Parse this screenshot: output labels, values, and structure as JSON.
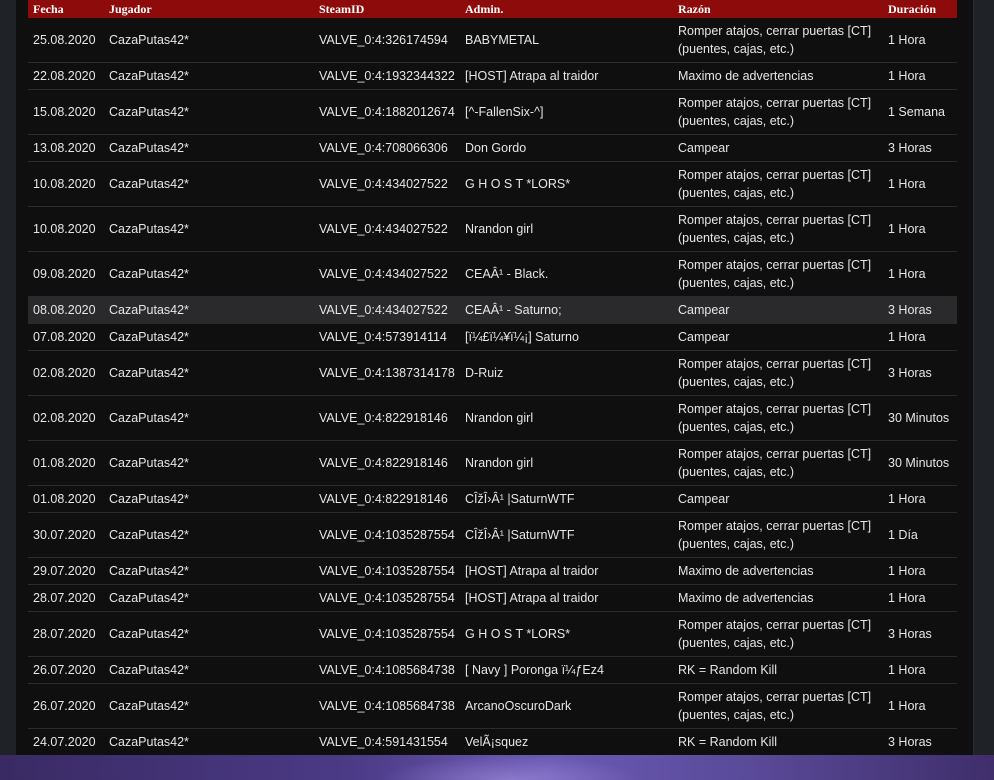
{
  "table": {
    "headers": {
      "fecha": "Fecha",
      "jugador": "Jugador",
      "steamid": "SteamID",
      "admin": "Admin.",
      "razon": "Razón",
      "duracion": "Duración"
    },
    "rows": [
      {
        "fecha": "25.08.2020",
        "jugador": "CazaPutas42*",
        "steamid": "VALVE_0:4:326174594",
        "admin": "BABYMETAL",
        "razon": "Romper atajos, cerrar puertas [CT] (puentes, cajas, etc.)",
        "duracion": "1 Hora"
      },
      {
        "fecha": "22.08.2020",
        "jugador": "CazaPutas42*",
        "steamid": "VALVE_0:4:1932344322",
        "admin": "[HOST] Atrapa al traidor",
        "razon": "Maximo de advertencias",
        "duracion": "1 Hora"
      },
      {
        "fecha": "15.08.2020",
        "jugador": "CazaPutas42*",
        "steamid": "VALVE_0:4:1882012674",
        "admin": "[^-FallenSix-^]",
        "razon": "Romper atajos, cerrar puertas [CT] (puentes, cajas, etc.)",
        "duracion": "1 Semana"
      },
      {
        "fecha": "13.08.2020",
        "jugador": "CazaPutas42*",
        "steamid": "VALVE_0:4:708066306",
        "admin": "Don Gordo",
        "razon": "Campear",
        "duracion": "3 Horas"
      },
      {
        "fecha": "10.08.2020",
        "jugador": "CazaPutas42*",
        "steamid": "VALVE_0:4:434027522",
        "admin": "G H O S T *LORS*",
        "razon": "Romper atajos, cerrar puertas [CT] (puentes, cajas, etc.)",
        "duracion": "1 Hora"
      },
      {
        "fecha": "10.08.2020",
        "jugador": "CazaPutas42*",
        "steamid": "VALVE_0:4:434027522",
        "admin": "Nrandon girl",
        "razon": "Romper atajos, cerrar puertas [CT] (puentes, cajas, etc.)",
        "duracion": "1 Hora"
      },
      {
        "fecha": "09.08.2020",
        "jugador": "CazaPutas42*",
        "steamid": "VALVE_0:4:434027522",
        "admin": "CEAÂ¹ - Black.",
        "razon": "Romper atajos, cerrar puertas [CT] (puentes, cajas, etc.)",
        "duracion": "1 Hora"
      },
      {
        "fecha": "08.08.2020",
        "jugador": "CazaPutas42*",
        "steamid": "VALVE_0:4:434027522",
        "admin": "CEAÂ¹ - Saturno;",
        "razon": "Campear",
        "duracion": "3 Horas"
      },
      {
        "fecha": "07.08.2020",
        "jugador": "CazaPutas42*",
        "steamid": "VALVE_0:4:573914114",
        "admin": "[ï¼£ï¼¥ï¼¡] Saturno",
        "razon": "Campear",
        "duracion": "1 Hora"
      },
      {
        "fecha": "02.08.2020",
        "jugador": "CazaPutas42*",
        "steamid": "VALVE_0:4:1387314178",
        "admin": "D-Ruiz",
        "razon": "Romper atajos, cerrar puertas [CT] (puentes, cajas, etc.)",
        "duracion": "3 Horas"
      },
      {
        "fecha": "02.08.2020",
        "jugador": "CazaPutas42*",
        "steamid": "VALVE_0:4:822918146",
        "admin": "Nrandon girl",
        "razon": "Romper atajos, cerrar puertas [CT] (puentes, cajas, etc.)",
        "duracion": "30 Minutos"
      },
      {
        "fecha": "01.08.2020",
        "jugador": "CazaPutas42*",
        "steamid": "VALVE_0:4:822918146",
        "admin": "Nrandon girl",
        "razon": "Romper atajos, cerrar puertas [CT] (puentes, cajas, etc.)",
        "duracion": "30 Minutos"
      },
      {
        "fecha": "01.08.2020",
        "jugador": "CazaPutas42*",
        "steamid": "VALVE_0:4:822918146",
        "admin": "CÎžÎ›Â¹ |SaturnWTF",
        "razon": "Campear",
        "duracion": "1 Hora"
      },
      {
        "fecha": "30.07.2020",
        "jugador": "CazaPutas42*",
        "steamid": "VALVE_0:4:1035287554",
        "admin": "CÎžÎ›Â¹ |SaturnWTF",
        "razon": "Romper atajos, cerrar puertas [CT] (puentes, cajas, etc.)",
        "duracion": "1 Día"
      },
      {
        "fecha": "29.07.2020",
        "jugador": "CazaPutas42*",
        "steamid": "VALVE_0:4:1035287554",
        "admin": "[HOST] Atrapa al traidor",
        "razon": "Maximo de advertencias",
        "duracion": "1 Hora"
      },
      {
        "fecha": "28.07.2020",
        "jugador": "CazaPutas42*",
        "steamid": "VALVE_0:4:1035287554",
        "admin": "[HOST] Atrapa al traidor",
        "razon": "Maximo de advertencias",
        "duracion": "1 Hora"
      },
      {
        "fecha": "28.07.2020",
        "jugador": "CazaPutas42*",
        "steamid": "VALVE_0:4:1035287554",
        "admin": "G H O S T *LORS*",
        "razon": "Romper atajos, cerrar puertas [CT] (puentes, cajas, etc.)",
        "duracion": "3 Horas"
      },
      {
        "fecha": "26.07.2020",
        "jugador": "CazaPutas42*",
        "steamid": "VALVE_0:4:1085684738",
        "admin": "[ Navy ] Poronga ï¼ƒEz4",
        "razon": "RK = Random Kill",
        "duracion": "1 Hora"
      },
      {
        "fecha": "26.07.2020",
        "jugador": "CazaPutas42*",
        "steamid": "VALVE_0:4:1085684738",
        "admin": "ArcanoOscuroDark",
        "razon": "Romper atajos, cerrar puertas [CT] (puentes, cajas, etc.)",
        "duracion": "1 Hora"
      },
      {
        "fecha": "24.07.2020",
        "jugador": "CazaPutas42*",
        "steamid": "VALVE_0:4:591431554",
        "admin": "VelÃ¡squez",
        "razon": "RK = Random Kill",
        "duracion": "3 Horas"
      }
    ],
    "highlighted_row_index": 7
  },
  "colors": {
    "header_bg": "#8e0b0b",
    "panel_bg": "#0f0f10",
    "page_bg": "#1f2227",
    "row_highlight": "#2a2a2c",
    "text": "#e6e6e6"
  }
}
